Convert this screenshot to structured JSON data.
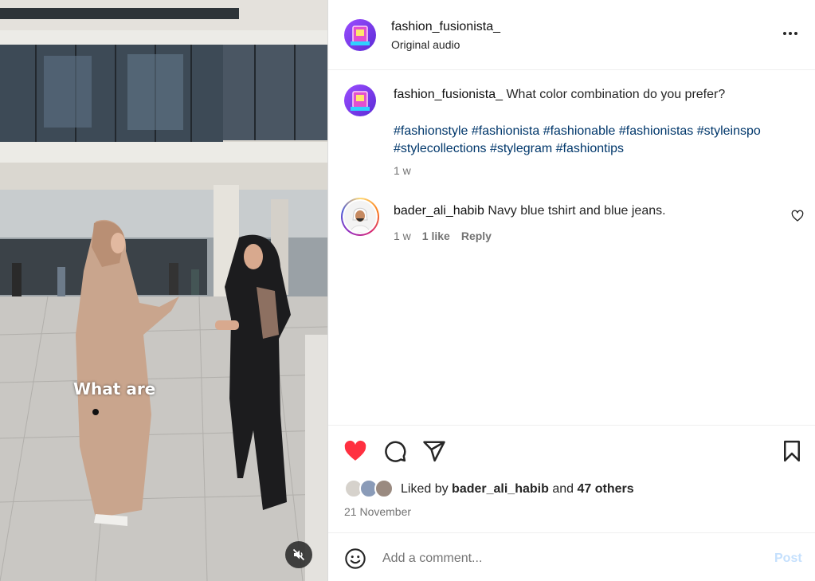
{
  "video": {
    "caption_overlay": "What are",
    "mute_icon": "speaker-muted-icon"
  },
  "header": {
    "username": "fashion_fusionista_",
    "subtitle": "Original audio",
    "more_icon": "more-horizontal-icon"
  },
  "caption": {
    "username": "fashion_fusionista_",
    "text": "What color combination do you prefer?",
    "hashtags_line1": [
      "#fashionstyle",
      "#fashionista",
      "#fashionable",
      "#fashionistas",
      "#styleinspo"
    ],
    "hashtags_line2": [
      "#stylecollections",
      "#stylegram",
      "#fashiontips"
    ],
    "time": "1 w"
  },
  "comments": [
    {
      "username": "bader_ali_habib",
      "text": "Navy blue tshirt and blue jeans.",
      "time": "1 w",
      "likes": "1 like",
      "reply": "Reply"
    }
  ],
  "actions": {
    "like_icon": "heart-filled-icon",
    "comment_icon": "comment-bubble-icon",
    "share_icon": "paper-plane-icon",
    "save_icon": "bookmark-icon",
    "liked_prefix": "Liked by",
    "liked_user": "bader_ali_habib",
    "liked_and": "and",
    "liked_others": "47 others",
    "date": "21 November"
  },
  "comment_bar": {
    "placeholder": "Add a comment...",
    "post_label": "Post",
    "emoji_icon": "emoji-smile-icon"
  },
  "colors": {
    "like_red": "#ff3040",
    "hashtag_blue": "#00376b",
    "post_disabled": "#c5e0fd",
    "muted_text": "#737373"
  }
}
